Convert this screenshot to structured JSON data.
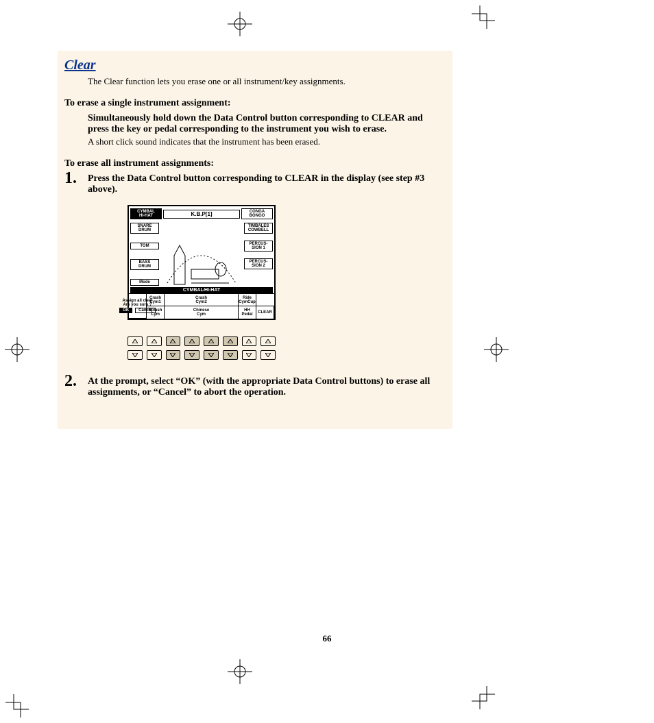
{
  "page_number": "66",
  "section_title": "Clear",
  "intro": "The Clear function lets you erase one or all instrument/key assignments.",
  "single": {
    "heading": "To erase a single instrument assignment:",
    "instruction": "Simultaneously hold down the Data Control button corresponding to CLEAR and press the key or pedal corresponding to the instrument you wish to erase.",
    "note": "A short click sound indicates that the instrument has been erased."
  },
  "all": {
    "heading": "To erase all instrument assignments:",
    "steps": [
      "Press the Data Control button corresponding to CLEAR in the display (see step #3 above).",
      "At the prompt, select “OK” (with the appropriate Data Control buttons) to erase all assignments, or “Cancel” to abort the operation."
    ]
  },
  "lcd": {
    "title": "K.B.P[1]",
    "left_tabs": [
      "CYMBAL\nHI-HAT",
      "SNARE\nDRUM",
      "TOM",
      "BASS\nDRUM",
      "Mode"
    ],
    "right_tabs": [
      "CONGA\nBONGO",
      "TIMBALES\nCOWBELL",
      "PERCUS-\nSION 1",
      "PERCUS-\nSION 2"
    ],
    "bar": "CYMBAL∕HI-HAT",
    "grid": {
      "r1c1": "Crash\nCym1",
      "r1c2": "Crash\nCym2",
      "r1c4": "Ride\nCymCup",
      "r2c1": "Splash\nCym",
      "r2c2": "Chinese\nCym",
      "r2c4": "HH\nPedal",
      "r2c5": "CLEAR"
    },
    "dialog": {
      "line1": "Assign all clear",
      "line2": "Are you sure ?",
      "ok": "OK",
      "cancel": "Cancel"
    }
  },
  "shaded_columns": [
    2,
    3,
    4,
    5
  ]
}
